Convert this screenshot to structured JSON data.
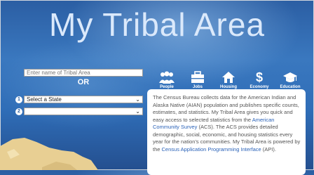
{
  "header": {
    "title": "My Tribal Area"
  },
  "search": {
    "placeholder": "Enter name of Tribal Area",
    "or_label": "OR"
  },
  "steps": {
    "one": "1",
    "two": "2"
  },
  "selects": {
    "state": {
      "value": "Select a State"
    },
    "area": {
      "value": ""
    }
  },
  "categories": [
    {
      "label": "People",
      "icon": "people-icon"
    },
    {
      "label": "Jobs",
      "icon": "briefcase-icon"
    },
    {
      "label": "Housing",
      "icon": "house-icon"
    },
    {
      "label": "Economy",
      "icon": "dollar-icon"
    },
    {
      "label": "Education",
      "icon": "graduation-cap-icon"
    }
  ],
  "description": {
    "text1": "The Census Bureau collects data for the American Indian and Alaska Native (AIAN) population and publishes specific counts, estimates, and statistics. My Tribal Area gives you quick and easy access to selected statistics from the ",
    "link1": "American Community Survey",
    "text2": " (ACS). The ACS provides detailed demographic, social, economic, and housing statistics every year for the nation's communities. My Tribal Area is powered by the ",
    "link2": "Census Application Programming Interface",
    "text3": " (API)."
  },
  "colors": {
    "accent": "#2a62b8",
    "title": "#dbe9fb",
    "map": "#e8cf93"
  }
}
